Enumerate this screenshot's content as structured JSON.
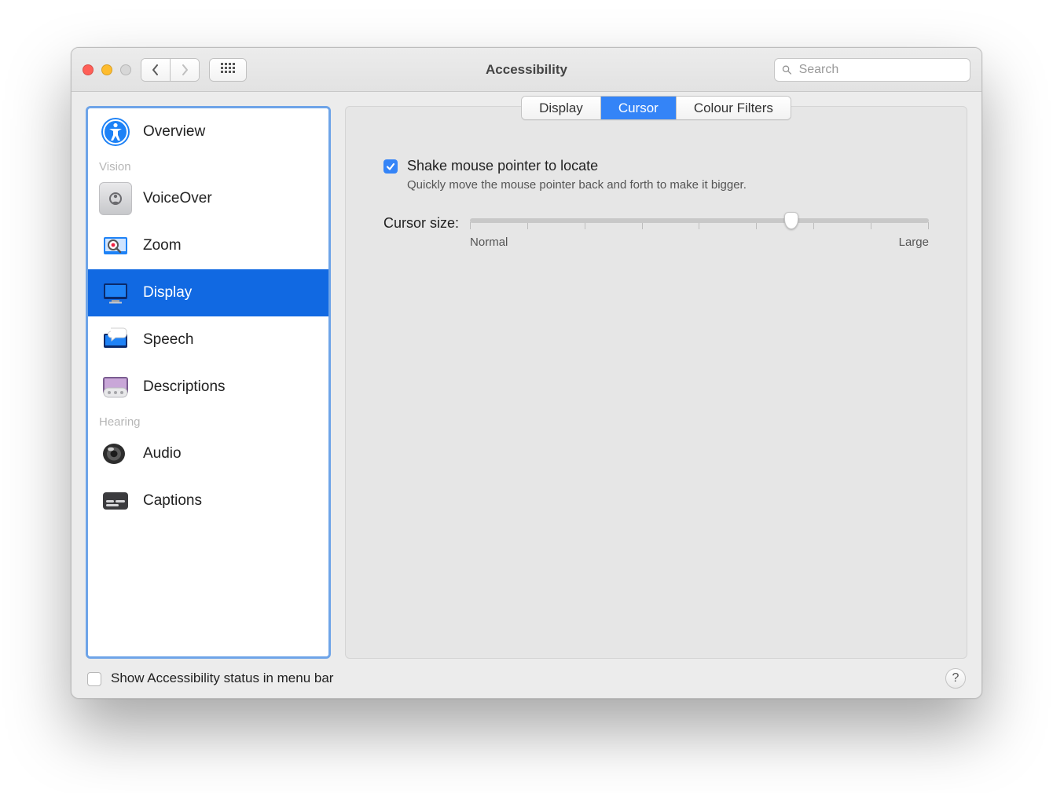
{
  "window": {
    "title": "Accessibility",
    "search_placeholder": "Search"
  },
  "sidebar": {
    "sections": {
      "vision_label": "Vision",
      "hearing_label": "Hearing"
    },
    "items": [
      {
        "label": "Overview",
        "icon": "accessibility-icon"
      },
      {
        "label": "VoiceOver",
        "icon": "voiceover-icon"
      },
      {
        "label": "Zoom",
        "icon": "zoom-icon"
      },
      {
        "label": "Display",
        "icon": "display-icon",
        "selected": true
      },
      {
        "label": "Speech",
        "icon": "speech-icon"
      },
      {
        "label": "Descriptions",
        "icon": "descriptions-icon"
      },
      {
        "label": "Audio",
        "icon": "audio-icon"
      },
      {
        "label": "Captions",
        "icon": "captions-icon"
      }
    ]
  },
  "tabs": {
    "items": [
      "Display",
      "Cursor",
      "Colour Filters"
    ],
    "active_index": 1
  },
  "cursor_pane": {
    "shake_checkbox": {
      "checked": true,
      "label": "Shake mouse pointer to locate",
      "description": "Quickly move the mouse pointer back and forth to make it bigger."
    },
    "cursor_size": {
      "label": "Cursor size:",
      "min_label": "Normal",
      "max_label": "Large",
      "value_percent": 70,
      "tick_count": 9
    }
  },
  "footer": {
    "menu_bar_checkbox": {
      "checked": false,
      "label": "Show Accessibility status in menu bar"
    },
    "help_label": "?"
  }
}
